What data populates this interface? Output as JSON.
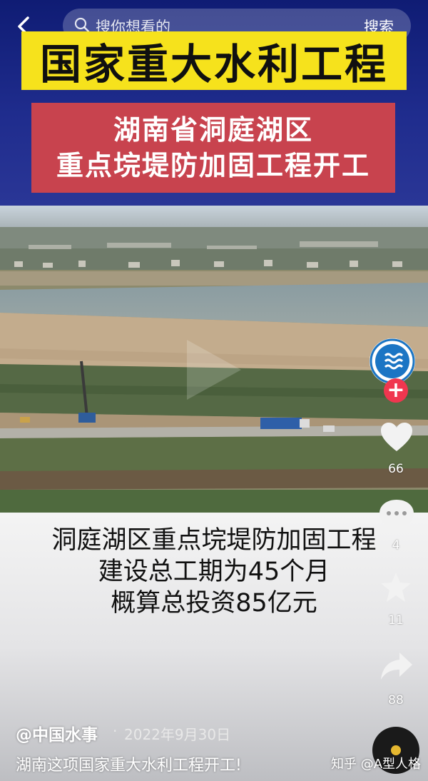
{
  "search": {
    "placeholder": "搜你想看的",
    "button": "搜索"
  },
  "banner": {
    "title": "国家重大水利工程",
    "subtitle_line1": "湖南省洞庭湖区",
    "subtitle_line2": "重点垸堤防加固工程开工"
  },
  "caption": {
    "line1": "洞庭湖区重点垸堤防加固工程",
    "line2": "建设总工期为45个月",
    "line3": "概算总投资85亿元"
  },
  "sidebar": {
    "likes": "66",
    "comments": "4",
    "favorites": "11",
    "shares": "88"
  },
  "post": {
    "author": "@中国水事",
    "separator": "·",
    "date": "2022年9月30日",
    "description": "湖南这项国家重大水利工程开工!"
  },
  "watermark": "知乎 @A型人格",
  "colors": {
    "banner_bg": "#1d2a86",
    "title_bg": "#f6e21c",
    "subtitle_bg": "#c8434e",
    "follow": "#f0364f",
    "avatar_ring": "#1b75c4"
  },
  "icons": [
    "back-icon",
    "search-icon",
    "play-icon",
    "heart-icon",
    "comment-icon",
    "star-icon",
    "share-icon",
    "music-disc-icon"
  ]
}
